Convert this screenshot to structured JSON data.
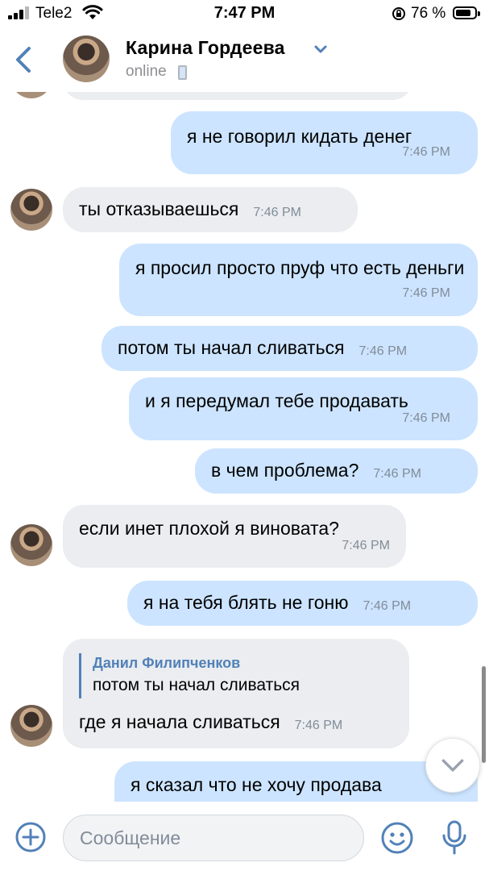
{
  "status_bar": {
    "carrier": "Tele2",
    "time": "7:47 PM",
    "battery_percent": "76 %",
    "battery_level": 0.76
  },
  "header": {
    "contact_name": "Карина Гордеева",
    "status": "online"
  },
  "messages": [
    {
      "dir": "in",
      "text": "",
      "time": ""
    },
    {
      "dir": "out",
      "text": "я не говорил кидать денег",
      "time": "7:46 PM"
    },
    {
      "dir": "in",
      "text": "ты отказываешься",
      "time": "7:46 PM"
    },
    {
      "dir": "out",
      "text": "я просил просто пруф что есть деньги",
      "time": "7:46 PM"
    },
    {
      "dir": "out",
      "text": "потом ты начал сливаться",
      "time": "7:46 PM"
    },
    {
      "dir": "out",
      "text": "и я передумал тебе продавать",
      "time": "7:46 PM"
    },
    {
      "dir": "out",
      "text": "в чем проблема?",
      "time": "7:46 PM"
    },
    {
      "dir": "in",
      "text": "если инет плохой я виновата?",
      "time": "7:46 PM"
    },
    {
      "dir": "out",
      "text": "я на тебя блять не гоню",
      "time": "7:46 PM"
    },
    {
      "dir": "in",
      "text": "где я начала сливаться",
      "time": "7:46 PM",
      "reply": {
        "author": "Данил Филипченков",
        "text": "потом ты начал сливаться"
      }
    },
    {
      "dir": "out",
      "text": "я сказал что не хочу продава",
      "time": ""
    }
  ],
  "composer": {
    "placeholder": "Сообщение"
  },
  "colors": {
    "accent": "#5181b8",
    "outgoing_bubble": "#cce4ff",
    "incoming_bubble": "#ebedf0",
    "timestamp": "#818c99"
  },
  "icons": {
    "back": "chevron-left-icon",
    "header_menu": "chevron-down-icon",
    "platform": "mobile-phone-icon",
    "scroll_down": "chevron-down-icon",
    "attach": "plus-circle-icon",
    "emoji": "smile-icon",
    "voice": "microphone-icon"
  }
}
